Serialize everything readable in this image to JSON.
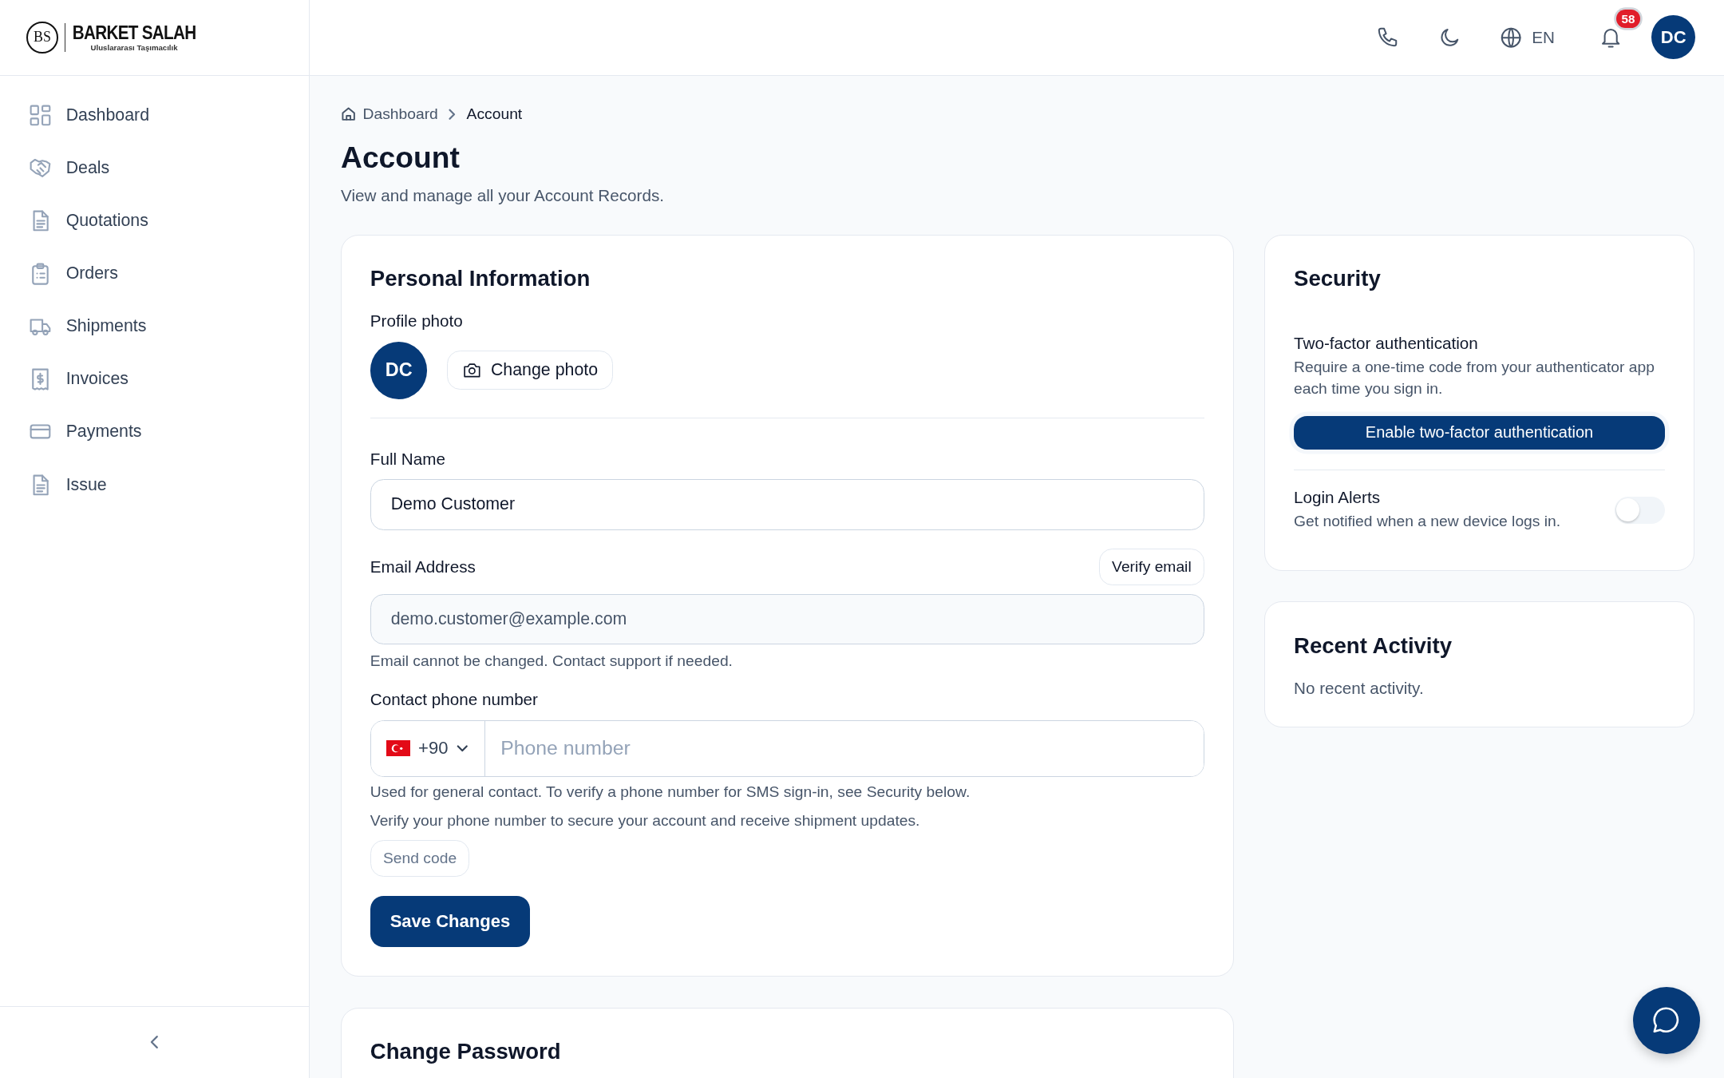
{
  "brand": {
    "monogram": "BS",
    "name": "BARKET SALAH",
    "tagline": "Uluslararası Taşımacılık"
  },
  "sidebar": {
    "items": [
      {
        "label": "Dashboard",
        "selected": false
      },
      {
        "label": "Deals",
        "selected": false
      },
      {
        "label": "Quotations",
        "selected": false
      },
      {
        "label": "Orders",
        "selected": false
      },
      {
        "label": "Shipments",
        "selected": false
      },
      {
        "label": "Invoices",
        "selected": false
      },
      {
        "label": "Payments",
        "selected": false
      },
      {
        "label": "Issue",
        "selected": false
      }
    ]
  },
  "topbar": {
    "language": "EN",
    "notification_count": "58",
    "avatar": "DC"
  },
  "breadcrumb": [
    "Dashboard",
    "Account"
  ],
  "page": {
    "title": "Account",
    "subtitle": "View and manage all your Account Records."
  },
  "personal": {
    "title": "Personal Information",
    "photo_label": "Profile photo",
    "avatar": "DC",
    "change_photo": "Change photo",
    "full_name": {
      "label": "Full Name",
      "value": "Demo Customer"
    },
    "email": {
      "label": "Email Address",
      "verify": "Verify email",
      "value": "demo.customer@example.com",
      "read_only": true,
      "help": "Email cannot be changed. Contact support if needed."
    },
    "phone": {
      "label": "Contact phone number",
      "code": "+90",
      "placeholder": "Phone number",
      "help": "Used for general contact. To verify a phone number for SMS sign-in, see Security below.",
      "note": "Verify your phone number to secure your account and receive shipment updates.",
      "send_code": {
        "label": "Send code",
        "disabled": true
      }
    },
    "save": "Save Changes"
  },
  "password": {
    "title": "Change Password"
  },
  "security": {
    "title": "Security",
    "two_factor": {
      "title": "Two-factor authentication",
      "description": "Require a one-time code from your authenticator app each time you sign in.",
      "button": "Enable two-factor authentication"
    },
    "login_alerts": {
      "title": "Login Alerts",
      "description": "Get notified when a new device logs in.",
      "on": false
    }
  },
  "activity": {
    "title": "Recent Activity",
    "empty": "No recent activity."
  }
}
